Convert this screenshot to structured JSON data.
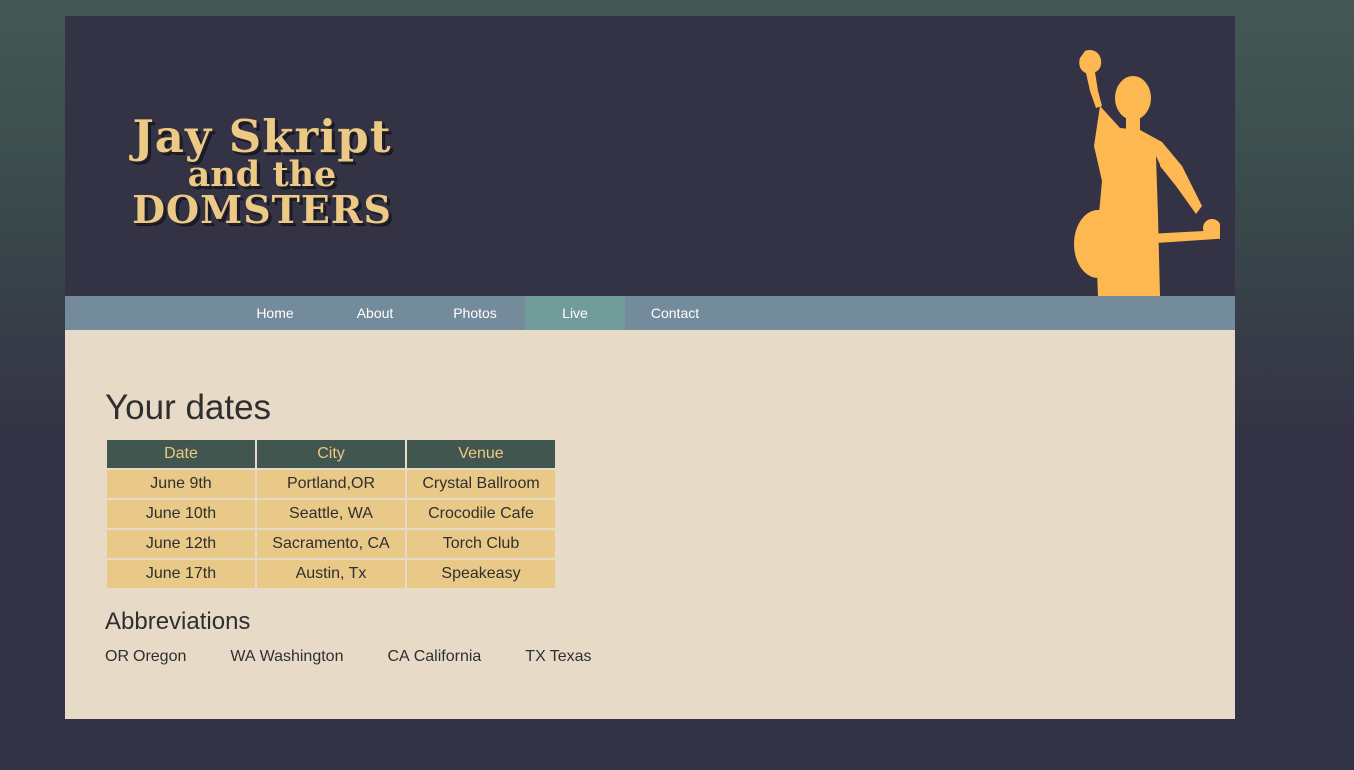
{
  "header": {
    "logo_line1": "Jay Skript",
    "logo_line2": "and the",
    "logo_line3": "DOMSTERS"
  },
  "nav": {
    "items": [
      {
        "label": "Home",
        "active": false
      },
      {
        "label": "About",
        "active": false
      },
      {
        "label": "Photos",
        "active": false
      },
      {
        "label": "Live",
        "active": true
      },
      {
        "label": "Contact",
        "active": false
      }
    ]
  },
  "main": {
    "title": "Your dates",
    "table": {
      "headers": [
        "Date",
        "City",
        "Venue"
      ],
      "rows": [
        [
          "June 9th",
          "Portland,OR",
          "Crystal Ballroom"
        ],
        [
          "June 10th",
          "Seattle, WA",
          "Crocodile Cafe"
        ],
        [
          "June 12th",
          "Sacramento, CA",
          "Torch Club"
        ],
        [
          "June 17th",
          "Austin, Tx",
          "Speakeasy"
        ]
      ]
    },
    "abbreviations": {
      "title": "Abbreviations",
      "items": [
        {
          "code": "OR",
          "name": "Oregon"
        },
        {
          "code": "WA",
          "name": "Washington"
        },
        {
          "code": "CA",
          "name": "California"
        },
        {
          "code": "TX",
          "name": "Texas"
        }
      ]
    }
  },
  "colors": {
    "header_bg": "#343345",
    "logo": "#ecc985",
    "silhouette": "#fdb851",
    "nav_bg": "#748b9b",
    "nav_active": "#719c9a",
    "content_bg": "#e7dbc7",
    "table_header_bg": "#40564f",
    "table_cell_bg": "#e9c987"
  },
  "icons": {
    "silhouette": "guitarist-silhouette-icon"
  }
}
